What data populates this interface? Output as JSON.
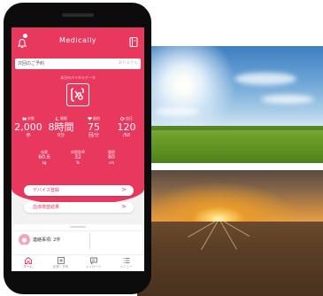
{
  "app": {
    "title": "Medically"
  },
  "appointment": {
    "label": "次回のご予約",
    "value": "ありません"
  },
  "vitals": {
    "heading": "本日のバイタルデータ",
    "stats": [
      {
        "label": "歩数",
        "value": "2,000",
        "unit": "歩",
        "icon": "footsteps-icon"
      },
      {
        "label": "睡眠",
        "value": "8時間",
        "unit": "0分",
        "icon": "moon-icon"
      },
      {
        "label": "脈拍",
        "value": "75",
        "unit": "回/分",
        "icon": "heart-icon"
      },
      {
        "label": "血圧",
        "value": "120",
        "unit": "/50",
        "icon": "blood-pressure-icon"
      }
    ],
    "small_stats": [
      {
        "label": "体重",
        "value": "60.6",
        "unit": "kg"
      },
      {
        "label": "体脂肪率",
        "value": "32",
        "unit": "%"
      },
      {
        "label": "腹囲",
        "value": "80",
        "unit": "cm"
      }
    ]
  },
  "actions": [
    {
      "label": "デバイス登録",
      "chevron": ">"
    },
    {
      "label": "血液検査結果",
      "chevron": ">"
    }
  ],
  "contact": {
    "text": "連絡事項: 2件"
  },
  "tabs": [
    {
      "label": "ホーム",
      "icon": "home-icon",
      "active": true
    },
    {
      "label": "記録・予約",
      "icon": "plus-square-icon",
      "active": false
    },
    {
      "label": "メッセージ",
      "icon": "chat-icon",
      "active": false
    },
    {
      "label": "メニュー",
      "icon": "menu-icon",
      "active": false
    }
  ],
  "colors": {
    "accent": "#e8385d",
    "background": "#f2f2f2"
  }
}
